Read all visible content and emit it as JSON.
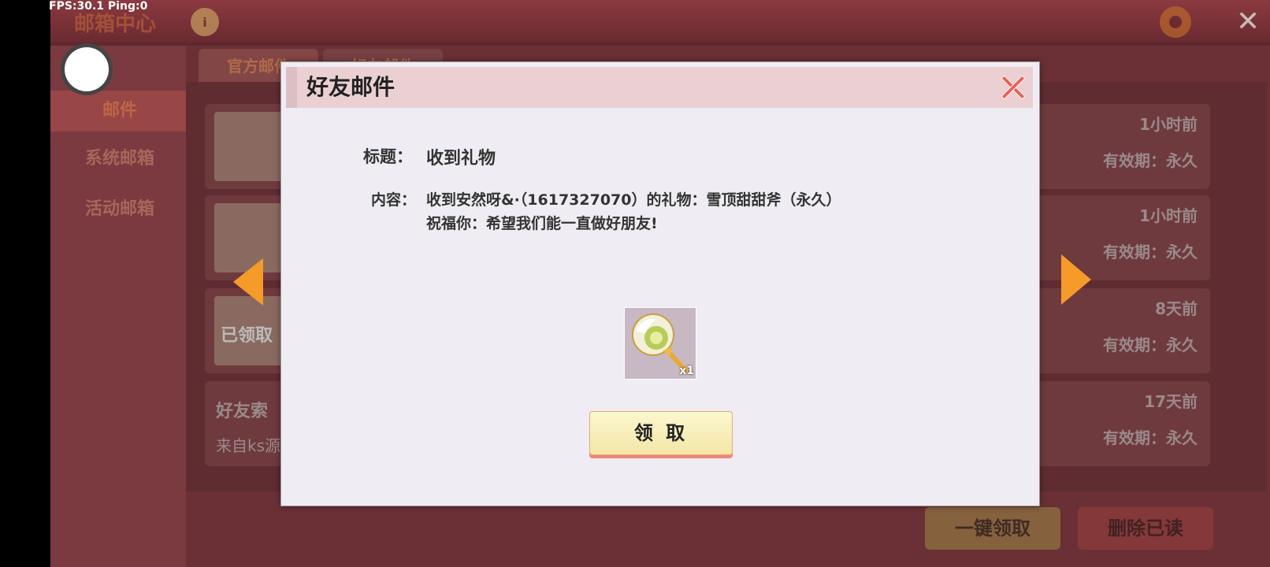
{
  "overlay": {
    "fps_label": "FPS:30.1  Ping:0"
  },
  "background": {
    "topbar_title": "邮箱中心",
    "info_icon_glyph": "i",
    "close_glyph": "✕",
    "side_tabs": [
      "邮件",
      "系统邮箱",
      "活动邮箱"
    ],
    "top_tabs": [
      "官方邮件",
      "好友邮件"
    ],
    "rows": [
      {
        "time": "1小时前",
        "valid": "有效期：永久"
      },
      {
        "time": "1小时前",
        "valid": "有效期：永久"
      },
      {
        "time": "8天前",
        "valid": "有效期：永久",
        "status": "已领取"
      },
      {
        "time": "17天前",
        "valid": "有效期：永久",
        "title": "好友索",
        "text": "来自ks源"
      }
    ],
    "claim_all_label": "一键领取",
    "delete_read_label": "删除已读"
  },
  "dialog": {
    "title": "好友邮件",
    "subject_label": "标题：",
    "subject_value": "收到礼物",
    "content_label": "内容：",
    "content_line1": "收到安然呀&·（1617327070）的礼物：雪顶甜甜斧（永久）",
    "content_line2": "祝福你：希望我们能一直做好朋友!",
    "item_icon": "lollipop-axe-icon",
    "item_count": "x1",
    "claim_label": "领 取"
  },
  "colors": {
    "accent_orange": "#f49b2a",
    "dialog_bg": "#efedf3",
    "header_bg": "#ead0d3",
    "close_red": "#e8625a"
  }
}
